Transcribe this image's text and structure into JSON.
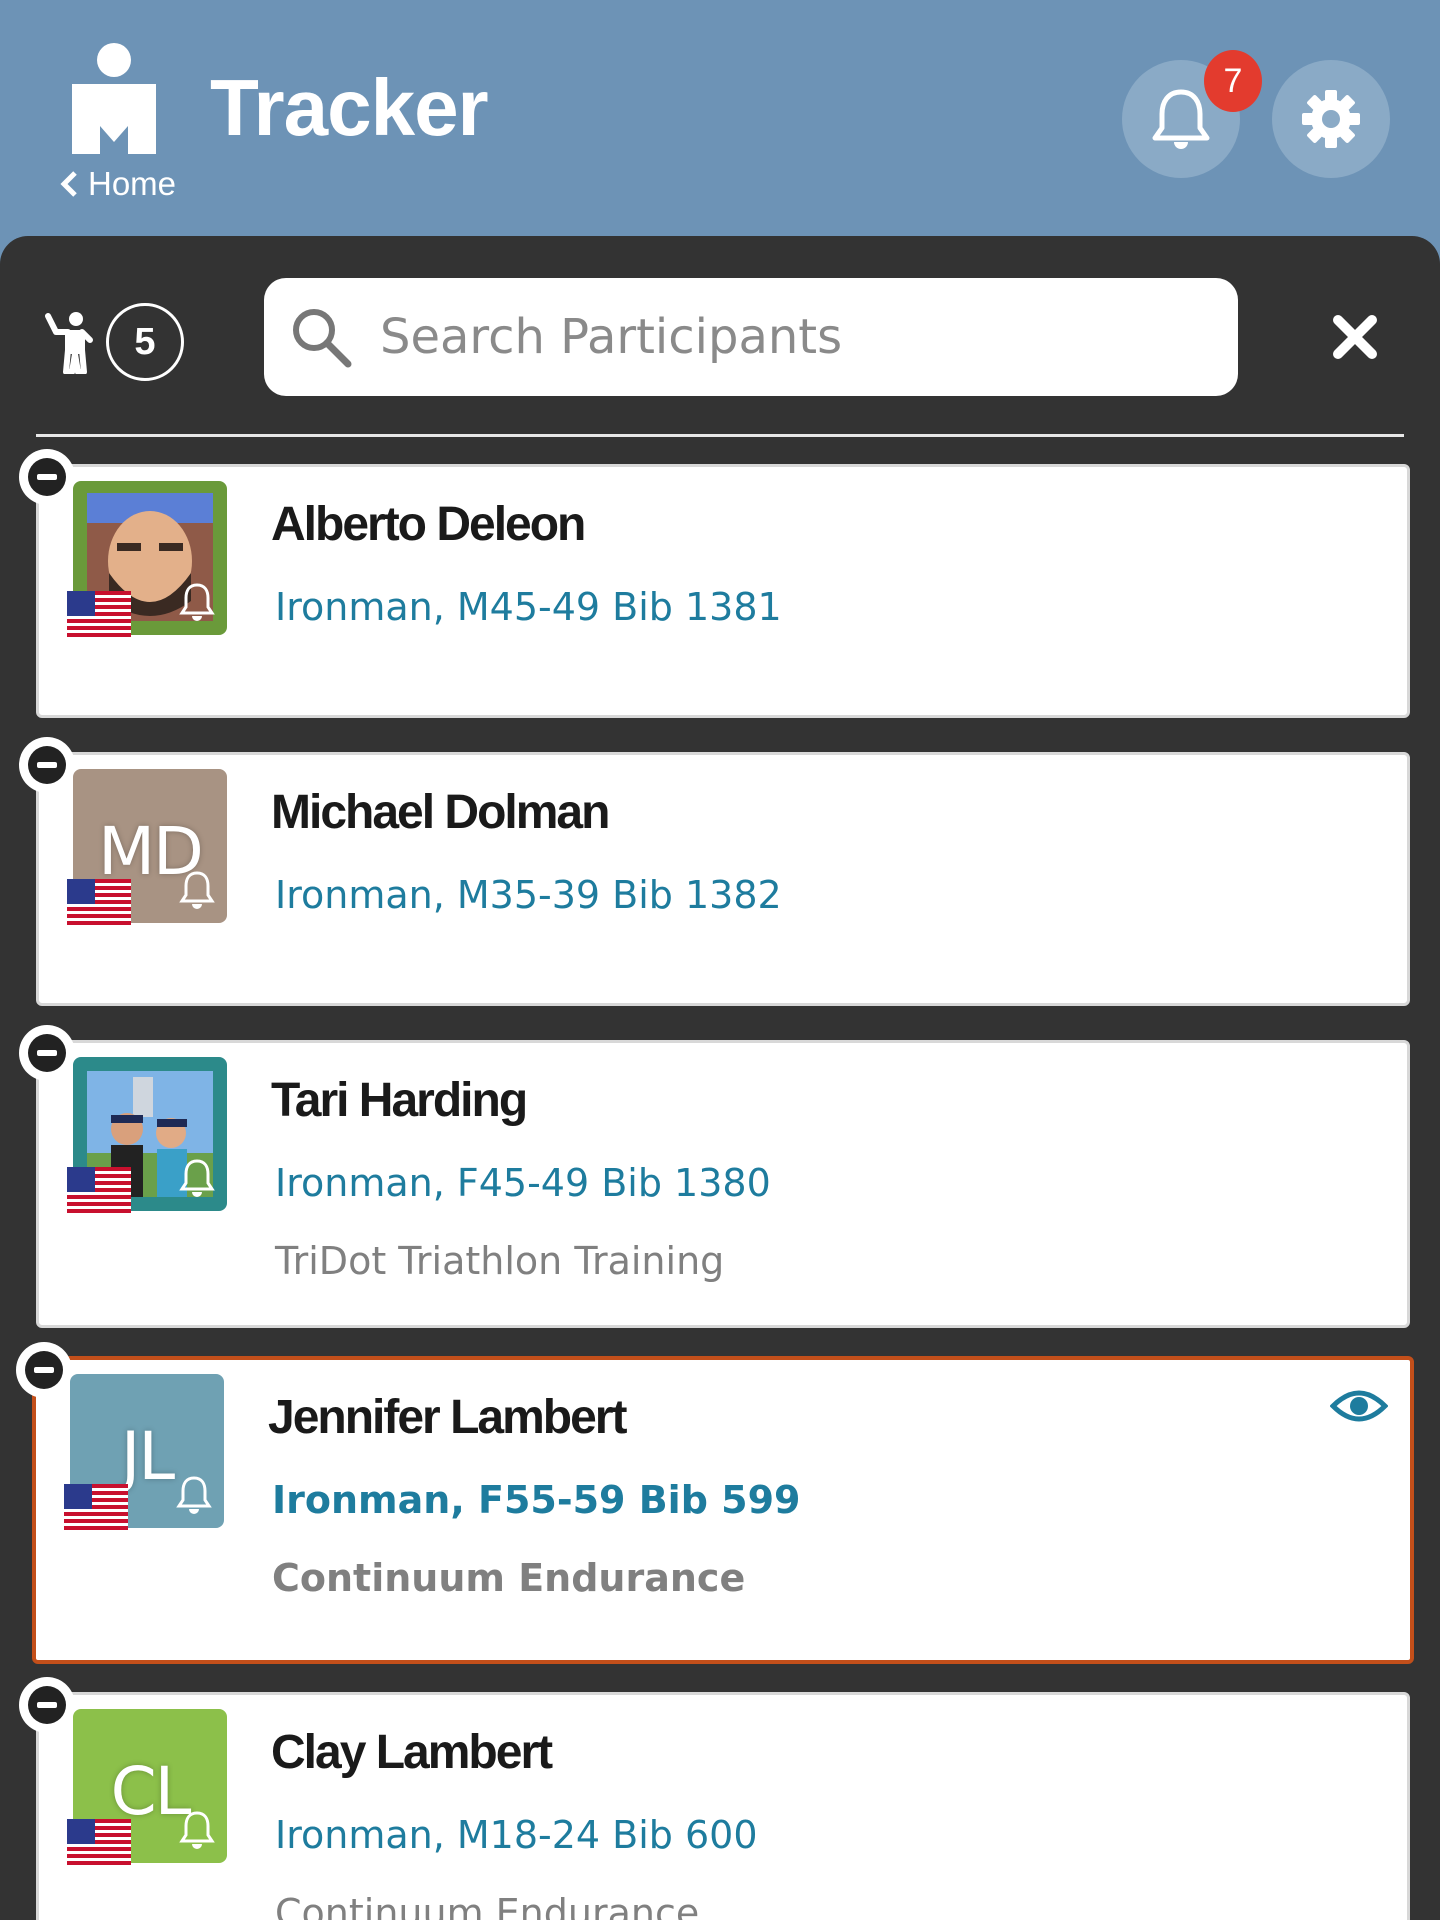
{
  "header": {
    "title": "Tracker",
    "home_label": "Home",
    "notification_count": "7"
  },
  "toolbar": {
    "participant_count": "5",
    "search_placeholder": "Search Participants"
  },
  "colors": {
    "header_bg": "#6d93b6",
    "panel_bg": "#333333",
    "link_blue": "#1e7c9e",
    "badge_red": "#e33b2e",
    "selected_border": "#c34f1a"
  },
  "participants": [
    {
      "name": "Alberto Deleon",
      "division": "Ironman, M45-49 Bib 1381",
      "team": "",
      "initials": "",
      "avatar_color": "#6a9a3a",
      "selected": false,
      "country_flag": "us-flag-icon"
    },
    {
      "name": "Michael Dolman",
      "division": "Ironman, M35-39 Bib 1382",
      "team": "",
      "initials": "MD",
      "avatar_color": "#a89383",
      "selected": false,
      "country_flag": "us-flag-icon"
    },
    {
      "name": "Tari Harding",
      "division": "Ironman, F45-49 Bib 1380",
      "team": "TriDot Triathlon Training",
      "initials": "",
      "avatar_color": "#2c8a8a",
      "selected": false,
      "country_flag": "us-flag-icon"
    },
    {
      "name": "Jennifer Lambert",
      "division": "Ironman, F55-59 Bib 599",
      "team": "Continuum Endurance",
      "initials": "JL",
      "avatar_color": "#6fa1b3",
      "selected": true,
      "country_flag": "us-flag-icon"
    },
    {
      "name": "Clay Lambert",
      "division": "Ironman, M18-24 Bib 600",
      "team": "Continuum Endurance",
      "initials": "CL",
      "avatar_color": "#8cc04a",
      "selected": false,
      "country_flag": "us-flag-icon"
    }
  ]
}
